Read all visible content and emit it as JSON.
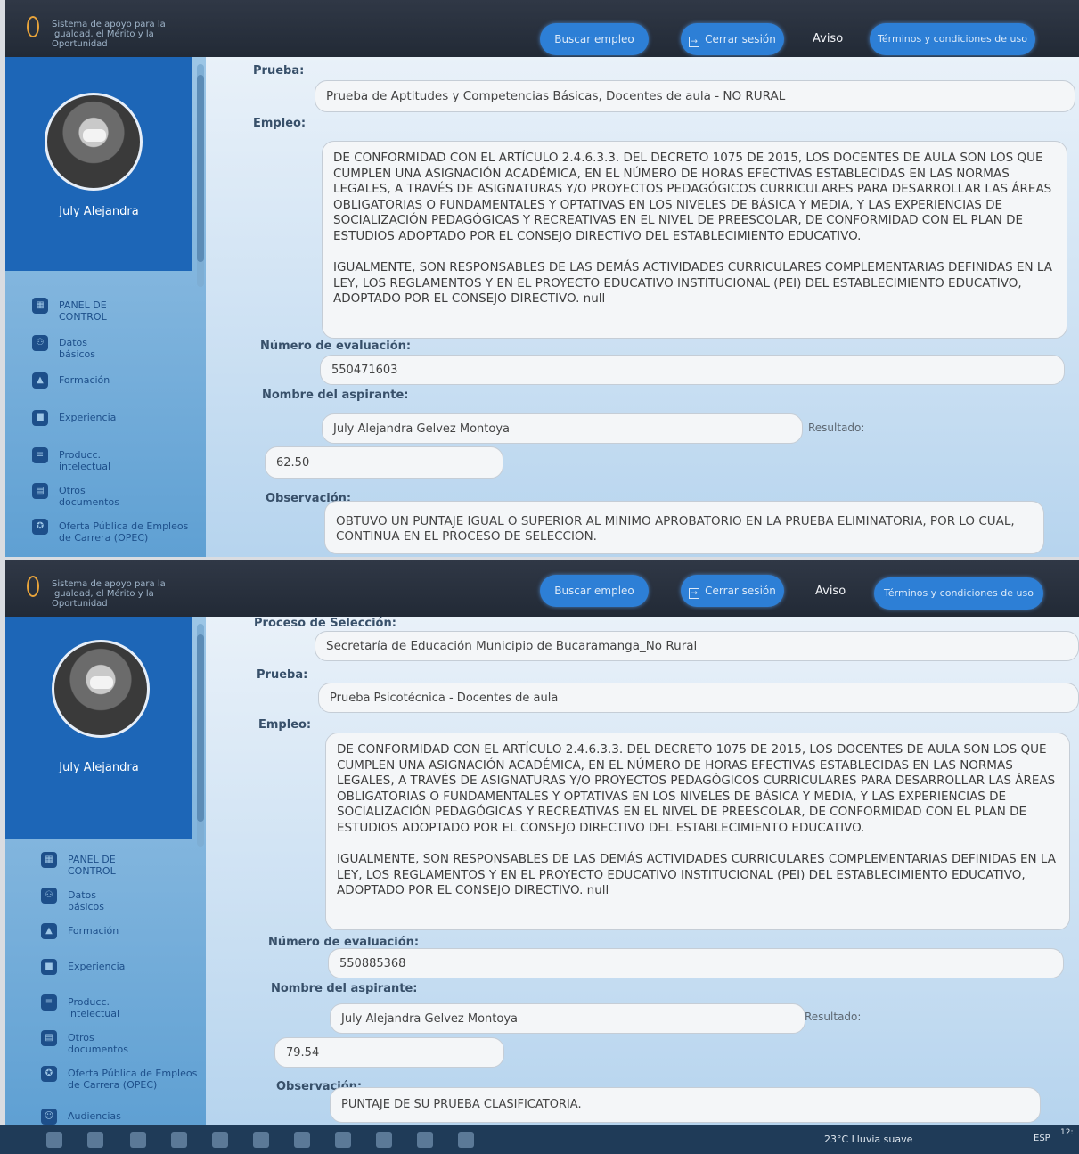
{
  "header": {
    "brand": "Sistema de apoyo para la Igualdad, el Mérito y la Oportunidad",
    "search_job": "Buscar empleo",
    "logout": "Cerrar sesión",
    "notice": "Aviso",
    "terms": "Términos y condiciones de uso"
  },
  "sidebar": {
    "user_name": "July Alejandra",
    "items": [
      {
        "label": "PANEL DE CONTROL",
        "icon": "dashboard-icon"
      },
      {
        "label": "Datos básicos",
        "icon": "users-icon"
      },
      {
        "label": "Formación",
        "icon": "graduation-icon"
      },
      {
        "label": "Experiencia",
        "icon": "briefcase-icon"
      },
      {
        "label": "Producc. intelectual",
        "icon": "document-icon"
      },
      {
        "label": "Otros documentos",
        "icon": "file-icon"
      },
      {
        "label": "Oferta Pública de Empleos de Carrera (OPEC)",
        "icon": "offer-icon"
      },
      {
        "label": "Audiencias",
        "icon": "audience-icon"
      }
    ]
  },
  "labels": {
    "process": "Proceso de Selección:",
    "test": "Prueba:",
    "job": "Empleo:",
    "eval_number": "Número de evaluación:",
    "applicant": "Nombre del aspirante:",
    "result": "Resultado:",
    "observation": "Observación:"
  },
  "job_text_1": "DE CONFORMIDAD CON EL ARTÍCULO 2.4.6.3.3. DEL DECRETO 1075 DE 2015, LOS DOCENTES DE AULA SON LOS QUE CUMPLEN UNA ASIGNACIÓN ACADÉMICA, EN EL NÚMERO DE HORAS EFECTIVAS ESTABLECIDAS EN LAS NORMAS LEGALES, A TRAVÉS DE ASIGNATURAS Y/O PROYECTOS PEDAGÓGICOS CURRICULARES PARA DESARROLLAR LAS ÁREAS OBLIGATORIAS O FUNDAMENTALES Y OPTATIVAS EN LOS NIVELES DE BÁSICA Y MEDIA, Y LAS EXPERIENCIAS DE SOCIALIZACIÓN PEDAGÓGICAS Y RECREATIVAS EN EL NIVEL DE PREESCOLAR, DE CONFORMIDAD CON EL PLAN DE ESTUDIOS ADOPTADO POR EL CONSEJO DIRECTIVO DEL ESTABLECIMIENTO EDUCATIVO.",
  "job_text_2": "IGUALMENTE, SON RESPONSABLES DE LAS DEMÁS ACTIVIDADES CURRICULARES COMPLEMENTARIAS DEFINIDAS EN LA LEY, LOS REGLAMENTOS Y EN EL PROYECTO EDUCATIVO INSTITUCIONAL (PEI) DEL ESTABLECIMIENTO EDUCATIVO, ADOPTADO POR EL CONSEJO DIRECTIVO. null",
  "screen1": {
    "test": "Prueba de Aptitudes y Competencias Básicas, Docentes de aula - NO RURAL",
    "eval_number": "550471603",
    "applicant": "July Alejandra Gelvez Montoya",
    "result": "62.50",
    "observation": "OBTUVO UN PUNTAJE IGUAL O SUPERIOR AL MINIMO APROBATORIO EN LA PRUEBA ELIMINATORIA, POR LO CUAL, CONTINUA EN EL PROCESO DE SELECCION."
  },
  "screen2": {
    "process": "Secretaría de Educación Municipio de Bucaramanga_No Rural",
    "test": "Prueba Psicotécnica - Docentes de aula",
    "eval_number": "550885368",
    "applicant": "July Alejandra Gelvez Montoya",
    "result": "79.54",
    "observation": "PUNTAJE DE SU PRUEBA CLASIFICATORIA."
  },
  "taskbar": {
    "weather": "23°C Lluvia suave",
    "lang": "ESP",
    "time": "12:"
  }
}
